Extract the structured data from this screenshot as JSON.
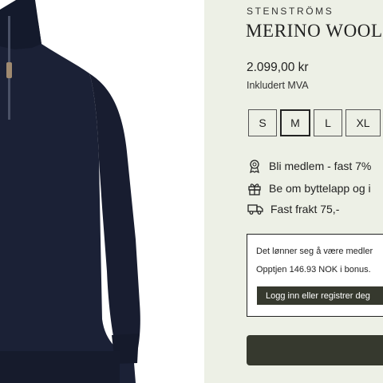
{
  "product": {
    "image_alt": "Navy merino wool half-zip sweater",
    "colors": {
      "sweater": "#1b2136",
      "background": "#edf0e6",
      "accent_dark": "#36392e"
    }
  },
  "info": {
    "brand": "STENSTRÖMS",
    "title": "MERINO WOOL",
    "price": "2.099,00 kr",
    "vat_note": "Inkludert MVA",
    "sizes": [
      {
        "label": "S",
        "selected": false
      },
      {
        "label": "M",
        "selected": true
      },
      {
        "label": "L",
        "selected": false
      },
      {
        "label": "XL",
        "selected": false
      }
    ],
    "usps": [
      {
        "icon": "medal-icon",
        "text": "Bli medlem - fast 7%"
      },
      {
        "icon": "gift-icon",
        "text": "Be om byttelapp og i"
      },
      {
        "icon": "truck-icon",
        "text": "Fast frakt 75,-"
      }
    ],
    "membership": {
      "line1": "Det lønner seg å være medler",
      "line2": "Opptjen 146.93 NOK i bonus.",
      "login_label": "Logg inn eller registrer deg"
    }
  }
}
